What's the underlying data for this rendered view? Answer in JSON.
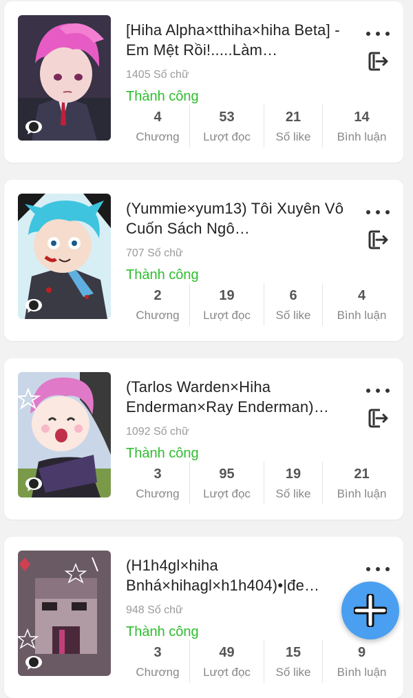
{
  "stories": [
    {
      "title": "[Hiha Alpha×tthiha×hiha Beta] - Em Mệt Rồi!.....Làm…",
      "words": "1405 Số chữ",
      "status": "Thành công",
      "stats": [
        {
          "value": "4",
          "label": "Chương"
        },
        {
          "value": "53",
          "label": "Lượt đọc"
        },
        {
          "value": "21",
          "label": "Số like"
        },
        {
          "value": "14",
          "label": "Bình luận"
        }
      ]
    },
    {
      "title": "(Yummie×yum13) Tôi Xuyên Vô Cuốn Sách Ngô…",
      "words": "707 Số chữ",
      "status": "Thành công",
      "stats": [
        {
          "value": "2",
          "label": "Chương"
        },
        {
          "value": "19",
          "label": "Lượt đọc"
        },
        {
          "value": "6",
          "label": "Số like"
        },
        {
          "value": "4",
          "label": "Bình luận"
        }
      ]
    },
    {
      "title": "(Tarlos Warden×Hiha Enderman×Ray Enderman)…",
      "words": "1092 Số chữ",
      "status": "Thành công",
      "stats": [
        {
          "value": "3",
          "label": "Chương"
        },
        {
          "value": "95",
          "label": "Lượt đọc"
        },
        {
          "value": "19",
          "label": "Số like"
        },
        {
          "value": "21",
          "label": "Bình luận"
        }
      ]
    },
    {
      "title": "(H1h4gl×hiha Bnhá×hihagl×h1h404)•|đe…",
      "words": "948 Số chữ",
      "status": "Thành công",
      "stats": [
        {
          "value": "3",
          "label": "Chương"
        },
        {
          "value": "49",
          "label": "Lượt đọc"
        },
        {
          "value": "15",
          "label": "Số like"
        },
        {
          "value": "9",
          "label": "Bình luận"
        }
      ]
    }
  ],
  "icons": {
    "more": "more-horizontal-icon",
    "exit": "exit-icon",
    "chat": "chat-bubble-icon",
    "fab": "plus-icon"
  },
  "colors": {
    "status": "#2ebd2e",
    "fab": "#4a9ff0",
    "background": "#f2f2f2"
  }
}
